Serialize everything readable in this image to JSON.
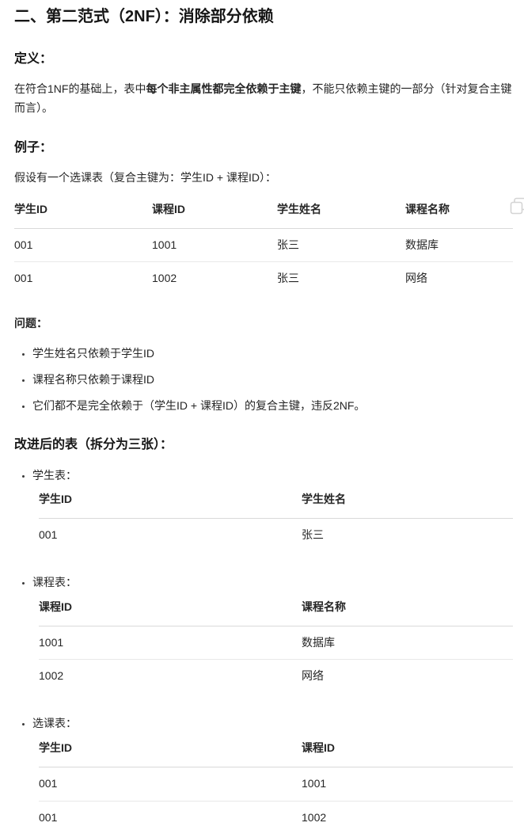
{
  "title": "二、第二范式（2NF）：消除部分依赖",
  "definition": {
    "heading": "定义：",
    "text_before": "在符合1NF的基础上，表中",
    "text_bold": "每个非主属性都完全依赖于主键",
    "text_after": "，不能只依赖主键的一部分（针对复合主键而言）。"
  },
  "example": {
    "heading": "例子：",
    "intro": "假设有一个选课表（复合主键为：学生ID + 课程ID）：",
    "copy_button_icon": "copy-icon",
    "table": {
      "headers": [
        "学生ID",
        "课程ID",
        "学生姓名",
        "课程名称"
      ],
      "rows": [
        [
          "001",
          "1001",
          "张三",
          "数据库"
        ],
        [
          "001",
          "1002",
          "张三",
          "网络"
        ]
      ]
    }
  },
  "problems": {
    "heading": "问题：",
    "items": [
      "学生姓名只依赖于学生ID",
      "课程名称只依赖于课程ID",
      "它们都不是完全依赖于（学生ID + 课程ID）的复合主键，违反2NF。"
    ]
  },
  "improved": {
    "heading": "改进后的表（拆分为三张）：",
    "tables": [
      {
        "label": "学生表：",
        "headers": [
          "学生ID",
          "学生姓名"
        ],
        "rows": [
          [
            "001",
            "张三"
          ]
        ]
      },
      {
        "label": "课程表：",
        "headers": [
          "课程ID",
          "课程名称"
        ],
        "rows": [
          [
            "1001",
            "数据库"
          ],
          [
            "1002",
            "网络"
          ]
        ]
      },
      {
        "label": "选课表：",
        "headers": [
          "学生ID",
          "课程ID"
        ],
        "rows": [
          [
            "001",
            "1001"
          ],
          [
            "001",
            "1002"
          ]
        ]
      }
    ]
  },
  "colors": {
    "text": "#262626",
    "heading_text": "#171717",
    "table_header_border": "#d9d9d9",
    "table_row_border": "#e9e9e9",
    "copy_icon": "#d4d4d4"
  }
}
